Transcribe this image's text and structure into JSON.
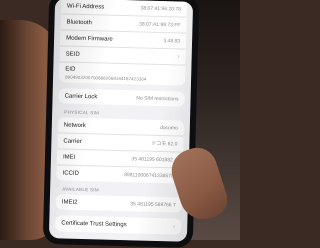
{
  "top_group": [
    {
      "label": "Wi-Fi Address",
      "value": "38:07:41:96:20:78"
    },
    {
      "label": "Bluetooth",
      "value": "38:07:A1:99:73:FF"
    },
    {
      "label": "Modem Firmware",
      "value": "3.48.83"
    },
    {
      "label": "SEID",
      "value": ""
    }
  ],
  "eid": {
    "label": "EID",
    "value": "89049032007008882668144187423364"
  },
  "carrier_lock": {
    "label": "Carrier Lock",
    "value": "No SIM restrictions"
  },
  "physical_sim": {
    "header": "PHYSICAL SIM",
    "rows": [
      {
        "label": "Network",
        "value": "docomo"
      },
      {
        "label": "Carrier",
        "value": "ドコモ 62.0"
      },
      {
        "label": "IMEI",
        "value": "35 481195 601882 4"
      },
      {
        "label": "ICCID",
        "value": "8981100067413385786"
      }
    ]
  },
  "available_sim": {
    "header": "AVAILABLE SIM",
    "rows": [
      {
        "label": "IMEI2",
        "value": "35 481195 589766 7"
      }
    ]
  },
  "certificate": {
    "label": "Certificate Trust Settings",
    "chevron": "›"
  }
}
